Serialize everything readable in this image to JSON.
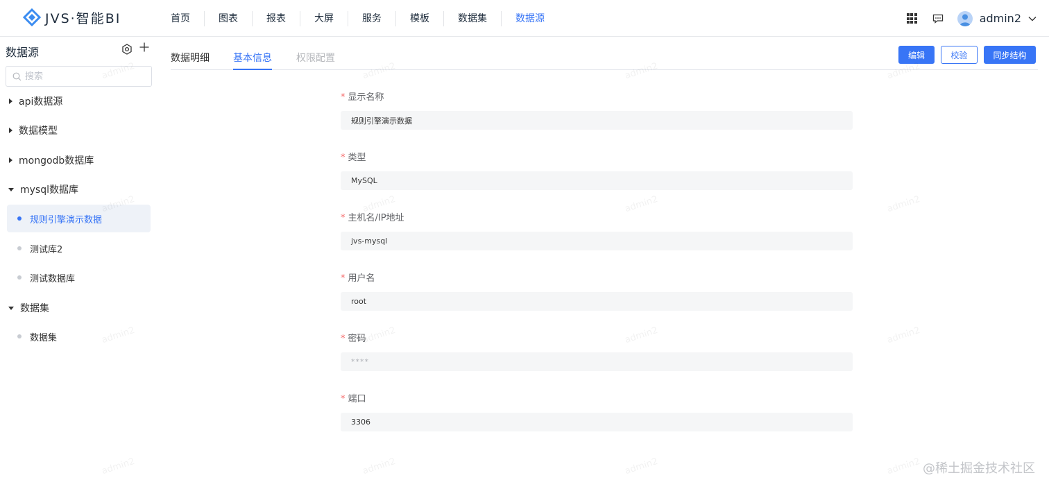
{
  "header": {
    "brand": "JVS·智能BI",
    "nav": [
      "首页",
      "图表",
      "报表",
      "大屏",
      "服务",
      "模板",
      "数据集",
      "数据源"
    ],
    "active_nav_index": 7,
    "user": "admin2",
    "accent": "#3875f6"
  },
  "sidebar": {
    "title": "数据源",
    "search_placeholder": "搜索",
    "groups": [
      {
        "label": "api数据源",
        "expanded": false
      },
      {
        "label": "数据模型",
        "expanded": false
      },
      {
        "label": "mongodb数据库",
        "expanded": false
      },
      {
        "label": "mysql数据库",
        "expanded": true,
        "items": [
          "规则引擎演示数据",
          "测试库2",
          "测试数据库"
        ]
      },
      {
        "label": "数据集",
        "expanded": true,
        "items": [
          "数据集"
        ]
      }
    ],
    "active_item": "规则引擎演示数据"
  },
  "main": {
    "tabs": [
      "数据明细",
      "基本信息",
      "权限配置"
    ],
    "active_tab": "基本信息",
    "buttons": {
      "edit": "编辑",
      "verify": "校验",
      "sync": "同步结构"
    },
    "fields": [
      {
        "label": "显示名称",
        "value": "规则引擎演示数据"
      },
      {
        "label": "类型",
        "value": "MySQL"
      },
      {
        "label": "主机名/IP地址",
        "value": "jvs-mysql"
      },
      {
        "label": "用户名",
        "value": "root"
      },
      {
        "label": "密码",
        "value": "****"
      },
      {
        "label": "端口",
        "value": "3306"
      }
    ]
  },
  "watermark_text": "admin2",
  "footer_brand": "@稀土掘金技术社区"
}
